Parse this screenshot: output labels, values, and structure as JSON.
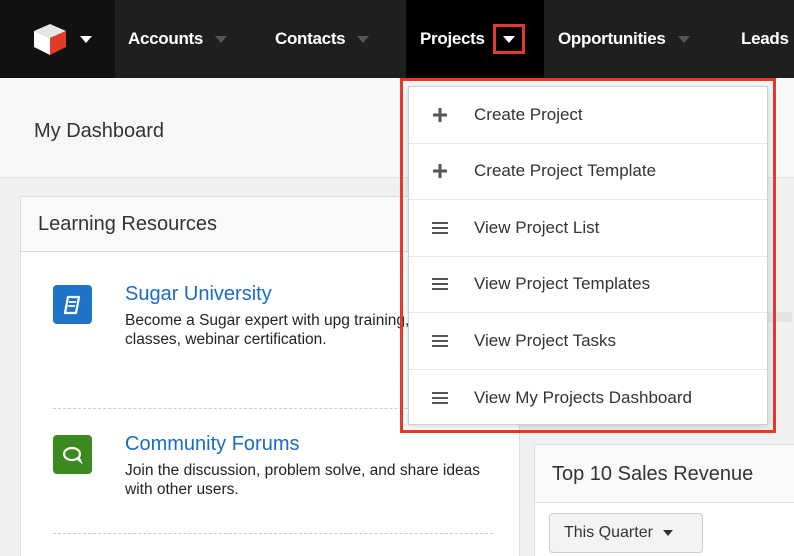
{
  "nav": {
    "items": [
      {
        "label": "Accounts"
      },
      {
        "label": "Contacts"
      },
      {
        "label": "Projects"
      },
      {
        "label": "Opportunities"
      },
      {
        "label": "Leads"
      }
    ]
  },
  "dashboard": {
    "title": "My Dashboard"
  },
  "learning": {
    "title": "Learning Resources",
    "resources": [
      {
        "title": "Sugar University",
        "desc": "Become a Sugar expert with upg training, videos, classes, webinar certification.",
        "icon": "book-icon"
      },
      {
        "title": "Community Forums",
        "desc": "Join the discussion, problem solve, and share ideas with other users.",
        "icon": "chat-icon"
      }
    ]
  },
  "sales_dashlet": {
    "title": "Top 10 Sales Revenue",
    "filter": "This Quarter"
  },
  "projects_menu": {
    "items": [
      {
        "label": "Create Project",
        "icon": "plus-icon"
      },
      {
        "label": "Create Project Template",
        "icon": "plus-icon"
      },
      {
        "label": "View Project List",
        "icon": "list-icon"
      },
      {
        "label": "View Project Templates",
        "icon": "list-icon"
      },
      {
        "label": "View Project Tasks",
        "icon": "list-icon"
      },
      {
        "label": "View My Projects Dashboard",
        "icon": "list-icon"
      }
    ]
  },
  "colors": {
    "highlight": "#e23b2a",
    "link": "#1a6bc6",
    "nav_bg": "#1f1f1f",
    "book_icon_bg": "#1e73c8",
    "chat_icon_bg": "#3b8a1f"
  }
}
